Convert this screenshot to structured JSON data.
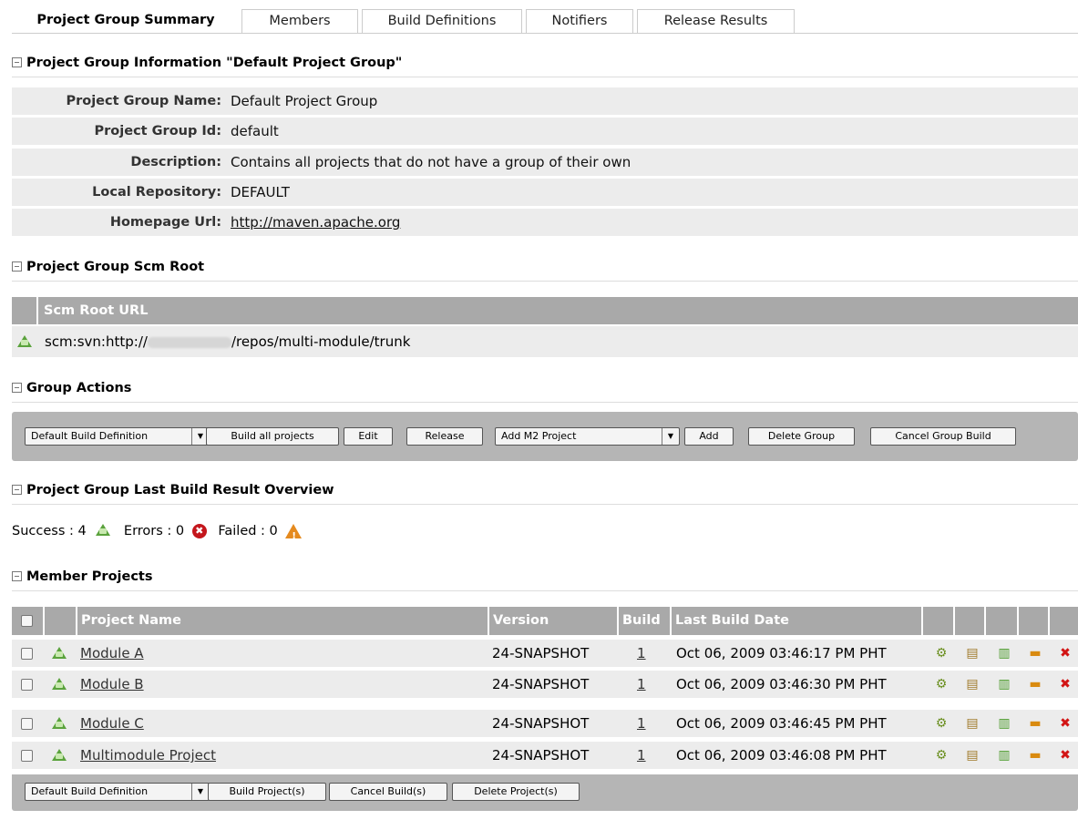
{
  "tabs": [
    "Project Group Summary",
    "Members",
    "Build Definitions",
    "Notifiers",
    "Release Results"
  ],
  "info": {
    "title": "Project Group Information \"Default Project Group\"",
    "rows": [
      {
        "label": "Project Group Name:",
        "value": "Default Project Group"
      },
      {
        "label": "Project Group Id:",
        "value": "default"
      },
      {
        "label": "Description:",
        "value": "Contains all projects that do not have a group of their own"
      },
      {
        "label": "Local Repository:",
        "value": "DEFAULT"
      },
      {
        "label": "Homepage Url:",
        "value": "http://maven.apache.org"
      }
    ]
  },
  "scm": {
    "title": "Project Group Scm Root",
    "header": "Scm Root URL",
    "prefix": "scm:svn:http://",
    "suffix": "/repos/multi-module/trunk"
  },
  "actions": {
    "title": "Group Actions",
    "build_def_select": "Default Build Definition",
    "build_all": "Build all projects",
    "edit": "Edit",
    "release": "Release",
    "add_select": "Add M2 Project",
    "add": "Add",
    "delete_group": "Delete Group",
    "cancel_group": "Cancel Group Build"
  },
  "overview": {
    "title": "Project Group Last Build Result Overview",
    "success": "Success : 4",
    "errors": "Errors : 0",
    "failed": "Failed : 0"
  },
  "members": {
    "title": "Member Projects",
    "columns": {
      "name": "Project Name",
      "version": "Version",
      "build": "Build",
      "date": "Last Build Date"
    },
    "rows": [
      {
        "name": "Module A",
        "version": "24-SNAPSHOT",
        "build": "1",
        "date": "Oct 06, 2009 03:46:17 PM PHT"
      },
      {
        "name": "Module B",
        "version": "24-SNAPSHOT",
        "build": "1",
        "date": "Oct 06, 2009 03:46:30 PM PHT"
      },
      {
        "name": "Module C",
        "version": "24-SNAPSHOT",
        "build": "1",
        "date": "Oct 06, 2009 03:46:45 PM PHT"
      },
      {
        "name": "Multimodule Project",
        "version": "24-SNAPSHOT",
        "build": "1",
        "date": "Oct 06, 2009 03:46:08 PM PHT"
      }
    ],
    "bottom": {
      "build_def_select": "Default Build Definition",
      "build": "Build Project(s)",
      "cancel": "Cancel Build(s)",
      "delete": "Delete Project(s)"
    }
  },
  "colors": {
    "header_gray": "#a9a9a9",
    "row_gray": "#ececec",
    "ok_green": "#5aa23c",
    "error_red": "#c4161c",
    "warn_orange": "#e58a1e"
  }
}
